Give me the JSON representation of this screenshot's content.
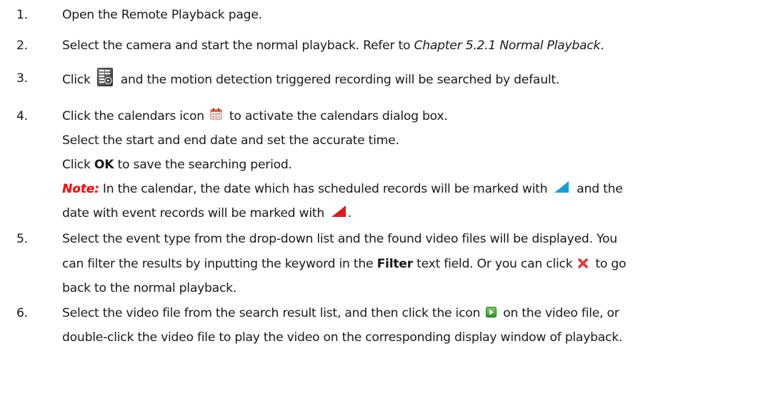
{
  "steps": [
    {
      "number": "1.",
      "text": "Open the Remote Playback page."
    },
    {
      "number": "2.",
      "text_before": "Select the camera and start the normal playback. Refer to ",
      "text_italic": "Chapter 5.2.1 Normal Playback",
      "text_after": "."
    },
    {
      "number": "3.",
      "text_before": "Click",
      "icon": "search-record-icon",
      "text_after": "and the motion detection triggered recording will be searched by default."
    },
    {
      "number": "4.",
      "text_before": "Click the calendars icon",
      "icon": "calendar-icon",
      "text_after": "to activate the calendars dialog box.",
      "line2": "Select the start and end date and set the accurate time.",
      "line3_before": "Click ",
      "line3_bold": "OK",
      "line3_after": " to save the searching period.",
      "note_label": "Note:",
      "note_text1": " In the calendar, the date which has scheduled records will be marked with",
      "note_text2": "and the",
      "note_text3": "date with event records will be marked with",
      "note_text4": ".",
      "scheduled_marker_color": "#1e9bd7",
      "event_marker_color": "#e0191e"
    },
    {
      "number": "5.",
      "line1": "Select the event type from the drop-down list and the found video files will be displayed. You",
      "line2_before": "can filter the results by inputting the keyword in the ",
      "line2_bold": "Filter",
      "line2_middle": " text field. Or you can click",
      "close_icon": "close-icon",
      "line2_after": "to go",
      "line3": "back to the normal playback."
    },
    {
      "number": "6.",
      "line1_before": "Select the video file from the search result list, and then click the icon",
      "play_icon": "play-icon",
      "line1_after": "on the video file, or",
      "line2": "double-click the video file to play the video on the corresponding display window of playback."
    }
  ]
}
